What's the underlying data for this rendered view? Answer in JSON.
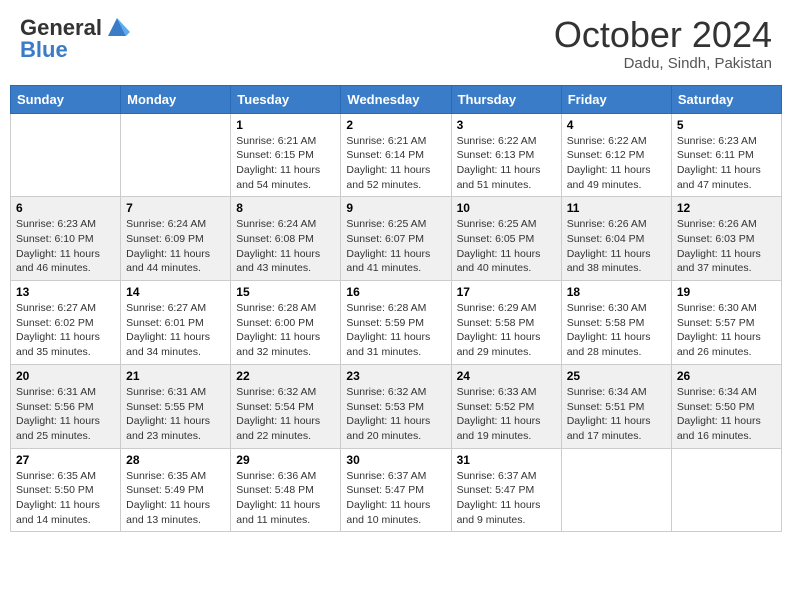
{
  "header": {
    "logo_general": "General",
    "logo_blue": "Blue",
    "month_title": "October 2024",
    "location": "Dadu, Sindh, Pakistan"
  },
  "weekdays": [
    "Sunday",
    "Monday",
    "Tuesday",
    "Wednesday",
    "Thursday",
    "Friday",
    "Saturday"
  ],
  "weeks": [
    [
      {
        "day": "",
        "sunrise": "",
        "sunset": "",
        "daylight": ""
      },
      {
        "day": "",
        "sunrise": "",
        "sunset": "",
        "daylight": ""
      },
      {
        "day": "1",
        "sunrise": "Sunrise: 6:21 AM",
        "sunset": "Sunset: 6:15 PM",
        "daylight": "Daylight: 11 hours and 54 minutes."
      },
      {
        "day": "2",
        "sunrise": "Sunrise: 6:21 AM",
        "sunset": "Sunset: 6:14 PM",
        "daylight": "Daylight: 11 hours and 52 minutes."
      },
      {
        "day": "3",
        "sunrise": "Sunrise: 6:22 AM",
        "sunset": "Sunset: 6:13 PM",
        "daylight": "Daylight: 11 hours and 51 minutes."
      },
      {
        "day": "4",
        "sunrise": "Sunrise: 6:22 AM",
        "sunset": "Sunset: 6:12 PM",
        "daylight": "Daylight: 11 hours and 49 minutes."
      },
      {
        "day": "5",
        "sunrise": "Sunrise: 6:23 AM",
        "sunset": "Sunset: 6:11 PM",
        "daylight": "Daylight: 11 hours and 47 minutes."
      }
    ],
    [
      {
        "day": "6",
        "sunrise": "Sunrise: 6:23 AM",
        "sunset": "Sunset: 6:10 PM",
        "daylight": "Daylight: 11 hours and 46 minutes."
      },
      {
        "day": "7",
        "sunrise": "Sunrise: 6:24 AM",
        "sunset": "Sunset: 6:09 PM",
        "daylight": "Daylight: 11 hours and 44 minutes."
      },
      {
        "day": "8",
        "sunrise": "Sunrise: 6:24 AM",
        "sunset": "Sunset: 6:08 PM",
        "daylight": "Daylight: 11 hours and 43 minutes."
      },
      {
        "day": "9",
        "sunrise": "Sunrise: 6:25 AM",
        "sunset": "Sunset: 6:07 PM",
        "daylight": "Daylight: 11 hours and 41 minutes."
      },
      {
        "day": "10",
        "sunrise": "Sunrise: 6:25 AM",
        "sunset": "Sunset: 6:05 PM",
        "daylight": "Daylight: 11 hours and 40 minutes."
      },
      {
        "day": "11",
        "sunrise": "Sunrise: 6:26 AM",
        "sunset": "Sunset: 6:04 PM",
        "daylight": "Daylight: 11 hours and 38 minutes."
      },
      {
        "day": "12",
        "sunrise": "Sunrise: 6:26 AM",
        "sunset": "Sunset: 6:03 PM",
        "daylight": "Daylight: 11 hours and 37 minutes."
      }
    ],
    [
      {
        "day": "13",
        "sunrise": "Sunrise: 6:27 AM",
        "sunset": "Sunset: 6:02 PM",
        "daylight": "Daylight: 11 hours and 35 minutes."
      },
      {
        "day": "14",
        "sunrise": "Sunrise: 6:27 AM",
        "sunset": "Sunset: 6:01 PM",
        "daylight": "Daylight: 11 hours and 34 minutes."
      },
      {
        "day": "15",
        "sunrise": "Sunrise: 6:28 AM",
        "sunset": "Sunset: 6:00 PM",
        "daylight": "Daylight: 11 hours and 32 minutes."
      },
      {
        "day": "16",
        "sunrise": "Sunrise: 6:28 AM",
        "sunset": "Sunset: 5:59 PM",
        "daylight": "Daylight: 11 hours and 31 minutes."
      },
      {
        "day": "17",
        "sunrise": "Sunrise: 6:29 AM",
        "sunset": "Sunset: 5:58 PM",
        "daylight": "Daylight: 11 hours and 29 minutes."
      },
      {
        "day": "18",
        "sunrise": "Sunrise: 6:30 AM",
        "sunset": "Sunset: 5:58 PM",
        "daylight": "Daylight: 11 hours and 28 minutes."
      },
      {
        "day": "19",
        "sunrise": "Sunrise: 6:30 AM",
        "sunset": "Sunset: 5:57 PM",
        "daylight": "Daylight: 11 hours and 26 minutes."
      }
    ],
    [
      {
        "day": "20",
        "sunrise": "Sunrise: 6:31 AM",
        "sunset": "Sunset: 5:56 PM",
        "daylight": "Daylight: 11 hours and 25 minutes."
      },
      {
        "day": "21",
        "sunrise": "Sunrise: 6:31 AM",
        "sunset": "Sunset: 5:55 PM",
        "daylight": "Daylight: 11 hours and 23 minutes."
      },
      {
        "day": "22",
        "sunrise": "Sunrise: 6:32 AM",
        "sunset": "Sunset: 5:54 PM",
        "daylight": "Daylight: 11 hours and 22 minutes."
      },
      {
        "day": "23",
        "sunrise": "Sunrise: 6:32 AM",
        "sunset": "Sunset: 5:53 PM",
        "daylight": "Daylight: 11 hours and 20 minutes."
      },
      {
        "day": "24",
        "sunrise": "Sunrise: 6:33 AM",
        "sunset": "Sunset: 5:52 PM",
        "daylight": "Daylight: 11 hours and 19 minutes."
      },
      {
        "day": "25",
        "sunrise": "Sunrise: 6:34 AM",
        "sunset": "Sunset: 5:51 PM",
        "daylight": "Daylight: 11 hours and 17 minutes."
      },
      {
        "day": "26",
        "sunrise": "Sunrise: 6:34 AM",
        "sunset": "Sunset: 5:50 PM",
        "daylight": "Daylight: 11 hours and 16 minutes."
      }
    ],
    [
      {
        "day": "27",
        "sunrise": "Sunrise: 6:35 AM",
        "sunset": "Sunset: 5:50 PM",
        "daylight": "Daylight: 11 hours and 14 minutes."
      },
      {
        "day": "28",
        "sunrise": "Sunrise: 6:35 AM",
        "sunset": "Sunset: 5:49 PM",
        "daylight": "Daylight: 11 hours and 13 minutes."
      },
      {
        "day": "29",
        "sunrise": "Sunrise: 6:36 AM",
        "sunset": "Sunset: 5:48 PM",
        "daylight": "Daylight: 11 hours and 11 minutes."
      },
      {
        "day": "30",
        "sunrise": "Sunrise: 6:37 AM",
        "sunset": "Sunset: 5:47 PM",
        "daylight": "Daylight: 11 hours and 10 minutes."
      },
      {
        "day": "31",
        "sunrise": "Sunrise: 6:37 AM",
        "sunset": "Sunset: 5:47 PM",
        "daylight": "Daylight: 11 hours and 9 minutes."
      },
      {
        "day": "",
        "sunrise": "",
        "sunset": "",
        "daylight": ""
      },
      {
        "day": "",
        "sunrise": "",
        "sunset": "",
        "daylight": ""
      }
    ]
  ]
}
